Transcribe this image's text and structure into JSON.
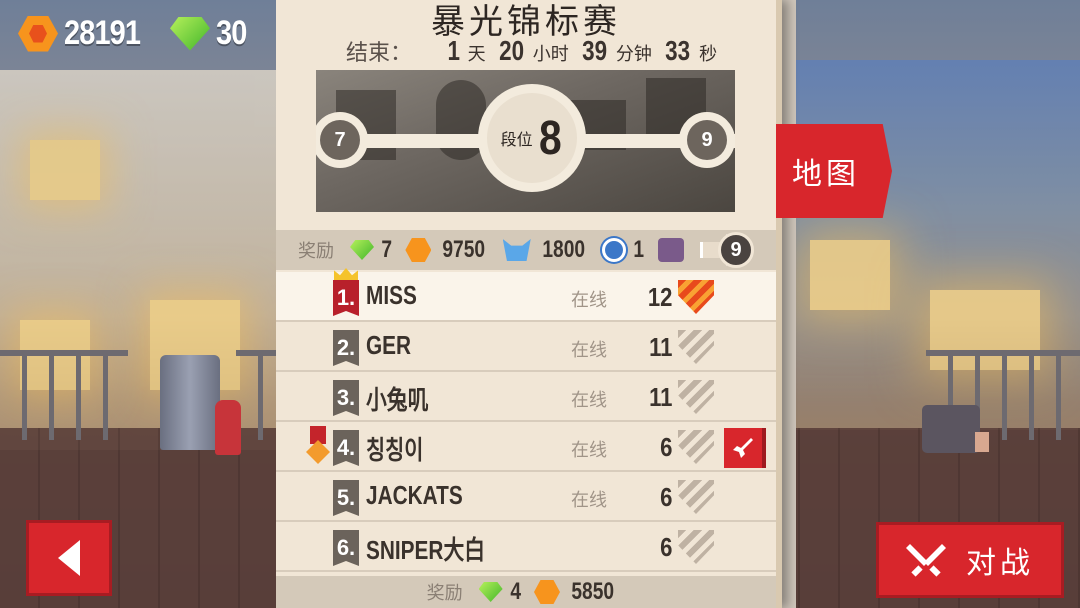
{
  "currency": {
    "coins": "28191",
    "gems": "30",
    "coin_icon": "orange-hexagon-coin-icon",
    "gem_icon": "green-gem-icon"
  },
  "top_buttons": {
    "shop_icon": "shop-bag-icon",
    "add_icon": "plus-icon"
  },
  "panel": {
    "title": "暴光锦标赛",
    "countdown": {
      "label": "结束：",
      "days": "1",
      "days_unit": "天",
      "hours": "20",
      "hours_unit": "小时",
      "minutes": "39",
      "minutes_unit": "分钟",
      "seconds": "33",
      "seconds_unit": "秒"
    },
    "rank": {
      "prev": "7",
      "label": "段位",
      "current": "8",
      "next": "9"
    },
    "reward": {
      "label": "奖励",
      "gems": "7",
      "coins": "9750",
      "fox": "1800",
      "paw": "1",
      "promote_to": "9"
    },
    "leaderboard": [
      {
        "pos": "1.",
        "name": "MISS",
        "status": "在线",
        "score": "12",
        "crown": true,
        "me": true
      },
      {
        "pos": "2.",
        "name": "GER",
        "status": "在线",
        "score": "11"
      },
      {
        "pos": "3.",
        "name": "小兔叽",
        "status": "在线",
        "score": "11"
      },
      {
        "pos": "4.",
        "name": "칭칭이",
        "status": "在线",
        "score": "6",
        "medal": true,
        "attack": true
      },
      {
        "pos": "5.",
        "name": "JACKATS",
        "status": "在线",
        "score": "6"
      },
      {
        "pos": "6.",
        "name": "SNIPER大白",
        "status": "",
        "score": "6"
      }
    ],
    "bottom_reward": {
      "label": "奖励",
      "gems": "4",
      "coins": "5850"
    }
  },
  "buttons": {
    "map": "地图",
    "battle": "对战",
    "back_icon": "back-arrow-icon",
    "battle_icon": "crossed-swords-icon"
  },
  "colors": {
    "accent_red": "#d8262c",
    "panel_bg": "#f1e6d6",
    "coin_orange": "#f7941d",
    "gem_green": "#40b52a"
  }
}
